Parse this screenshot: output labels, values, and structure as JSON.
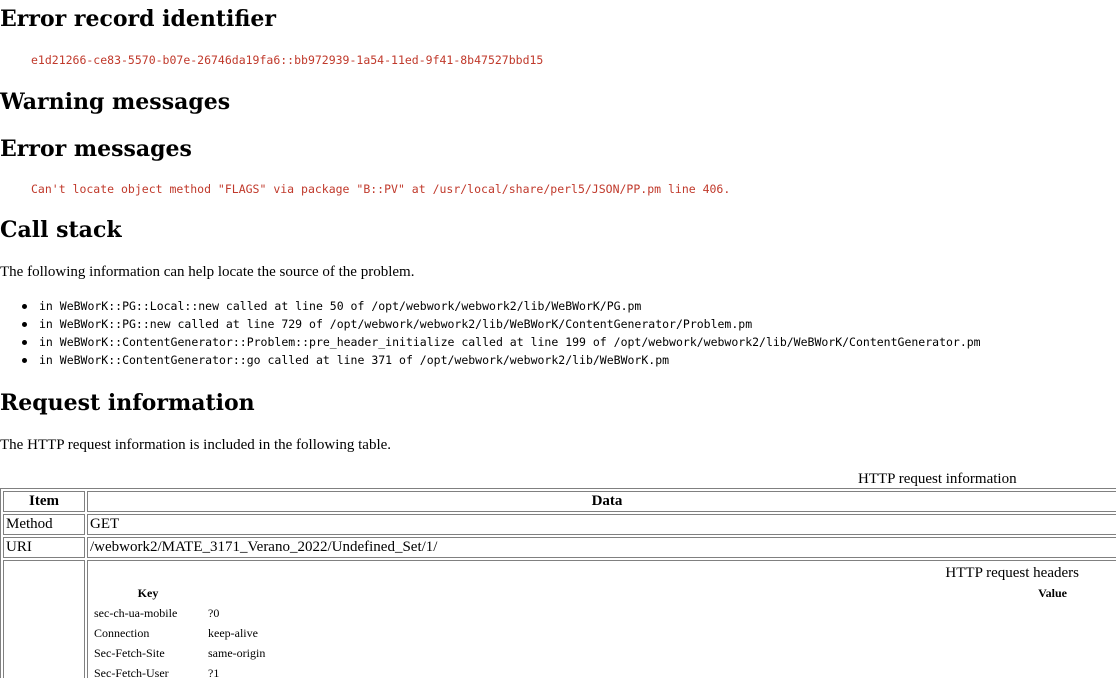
{
  "sections": {
    "error_record_heading": "Error record identifier",
    "error_record_id": "e1d21266-ce83-5570-b07e-26746da19fa6::bb972939-1a54-11ed-9f41-8b47527bbd15",
    "warning_heading": "Warning messages",
    "error_messages_heading": "Error messages",
    "error_message": "Can't locate object method \"FLAGS\" via package \"B::PV\" at /usr/local/share/perl5/JSON/PP.pm line 406.",
    "call_stack_heading": "Call stack",
    "call_stack_intro": "The following information can help locate the source of the problem.",
    "call_stack": [
      "in WeBWorK::PG::Local::new called at line 50 of /opt/webwork/webwork2/lib/WeBWorK/PG.pm",
      "in WeBWorK::PG::new called at line 729 of /opt/webwork/webwork2/lib/WeBWorK/ContentGenerator/Problem.pm",
      "in WeBWorK::ContentGenerator::Problem::pre_header_initialize called at line 199 of /opt/webwork/webwork2/lib/WeBWorK/ContentGenerator.pm",
      "in WeBWorK::ContentGenerator::go called at line 371 of /opt/webwork/webwork2/lib/WeBWorK.pm"
    ],
    "request_heading": "Request information",
    "request_intro": "The HTTP request information is included in the following table."
  },
  "request_table": {
    "caption": "HTTP request information",
    "col_item": "Item",
    "col_data": "Data",
    "rows": [
      {
        "item": "Method",
        "data": "GET"
      },
      {
        "item": "URI",
        "data": "/webwork2/MATE_3171_Verano_2022/Undefined_Set/1/"
      }
    ],
    "headers_caption": "HTTP request headers",
    "headers_col_key": "Key",
    "headers_col_value": "Value",
    "headers": [
      {
        "key": "sec-ch-ua-mobile",
        "value": "?0"
      },
      {
        "key": "Connection",
        "value": "keep-alive"
      },
      {
        "key": "Sec-Fetch-Site",
        "value": "same-origin"
      },
      {
        "key": "Sec-Fetch-User",
        "value": "?1"
      }
    ]
  }
}
